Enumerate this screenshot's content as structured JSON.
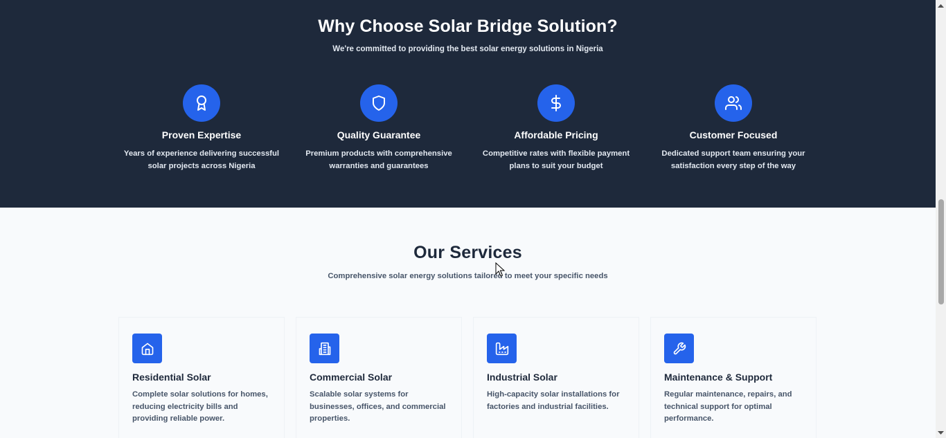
{
  "why": {
    "title": "Why Choose Solar Bridge Solution?",
    "subtitle": "We're committed to providing the best solar energy solutions in Nigeria",
    "features": [
      {
        "icon": "award-icon",
        "title": "Proven Expertise",
        "desc": "Years of experience delivering successful solar projects across Nigeria"
      },
      {
        "icon": "shield-icon",
        "title": "Quality Guarantee",
        "desc": "Premium products with comprehensive warranties and guarantees"
      },
      {
        "icon": "dollar-icon",
        "title": "Affordable Pricing",
        "desc": "Competitive rates with flexible payment plans to suit your budget"
      },
      {
        "icon": "users-icon",
        "title": "Customer Focused",
        "desc": "Dedicated support team ensuring your satisfaction every step of the way"
      }
    ]
  },
  "services": {
    "title": "Our Services",
    "subtitle": "Comprehensive solar energy solutions tailored to meet your specific needs",
    "items": [
      {
        "icon": "home-icon",
        "title": "Residential Solar",
        "desc": "Complete solar solutions for homes, reducing electricity bills and providing reliable power."
      },
      {
        "icon": "building-icon",
        "title": "Commercial Solar",
        "desc": "Scalable solar systems for businesses, offices, and commercial properties."
      },
      {
        "icon": "factory-icon",
        "title": "Industrial Solar",
        "desc": "High-capacity solar installations for factories and industrial facilities."
      },
      {
        "icon": "wrench-icon",
        "title": "Maintenance & Support",
        "desc": "Regular maintenance, repairs, and technical support for optimal performance."
      }
    ]
  },
  "colors": {
    "dark_bg": "#1e293b",
    "accent": "#2563eb",
    "light_bg": "#f8fafc",
    "heading": "#1e293b",
    "body_text": "#475569"
  }
}
